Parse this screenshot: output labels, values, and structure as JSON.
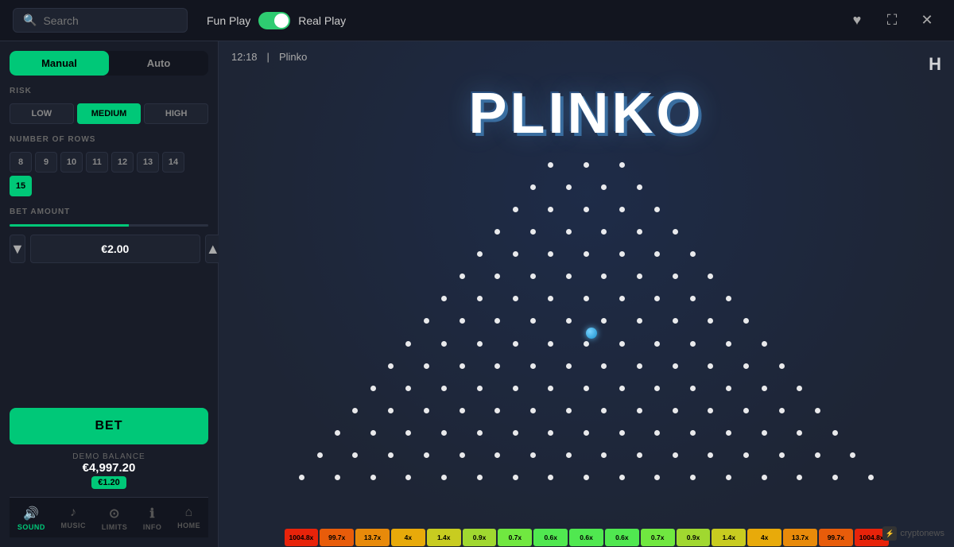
{
  "header": {
    "search_placeholder": "Search",
    "fun_play_label": "Fun Play",
    "real_play_label": "Real Play",
    "favorite_icon": "♥",
    "fullscreen_icon": "⛶",
    "close_icon": "✕"
  },
  "sidebar": {
    "tab_manual": "Manual",
    "tab_auto": "Auto",
    "risk_label": "RISK",
    "risk_options": [
      "LOW",
      "MEDIUM",
      "HIGH"
    ],
    "active_risk": "MEDIUM",
    "rows_label": "NUMBER OF ROWS",
    "row_values": [
      8,
      9,
      10,
      11,
      12,
      13,
      14,
      15
    ],
    "active_rows": 15,
    "bet_label": "BET AMOUNT",
    "bet_value": "€2.00",
    "bet_button": "BET",
    "demo_label": "DEMO BALANCE",
    "demo_amount": "€4,997.20",
    "last_win": "€1.20",
    "nav": [
      {
        "label": "SOUND",
        "icon": "🔊"
      },
      {
        "label": "MUSIC",
        "icon": "♪"
      },
      {
        "label": "LIMITS",
        "icon": "⊙"
      },
      {
        "label": "INFO",
        "icon": "ℹ"
      },
      {
        "label": "HOME",
        "icon": "⌂"
      }
    ]
  },
  "game": {
    "time": "12:18",
    "separator": "|",
    "name": "Plinko",
    "title": "PLINKO",
    "logo_icon": "H"
  },
  "multipliers": [
    {
      "value": "1004.8x",
      "color": "#e8230a"
    },
    {
      "value": "99.7x",
      "color": "#e85c0a"
    },
    {
      "value": "13.7x",
      "color": "#e88a0a"
    },
    {
      "value": "4x",
      "color": "#e8aa0a"
    },
    {
      "value": "1.4x",
      "color": "#c8cc20"
    },
    {
      "value": "0.9x",
      "color": "#a0d830"
    },
    {
      "value": "0.7x",
      "color": "#70e840"
    },
    {
      "value": "0.6x",
      "color": "#50e850"
    },
    {
      "value": "0.6x",
      "color": "#50e850"
    },
    {
      "value": "0.6x",
      "color": "#50e850"
    },
    {
      "value": "0.7x",
      "color": "#70e840"
    },
    {
      "value": "0.9x",
      "color": "#a0d830"
    },
    {
      "value": "1.4x",
      "color": "#c8cc20"
    },
    {
      "value": "4x",
      "color": "#e8aa0a"
    },
    {
      "value": "13.7x",
      "color": "#e88a0a"
    },
    {
      "value": "99.7x",
      "color": "#e85c0a"
    },
    {
      "value": "1004.8x",
      "color": "#e8230a"
    }
  ],
  "cryptonews": "cryptonews"
}
